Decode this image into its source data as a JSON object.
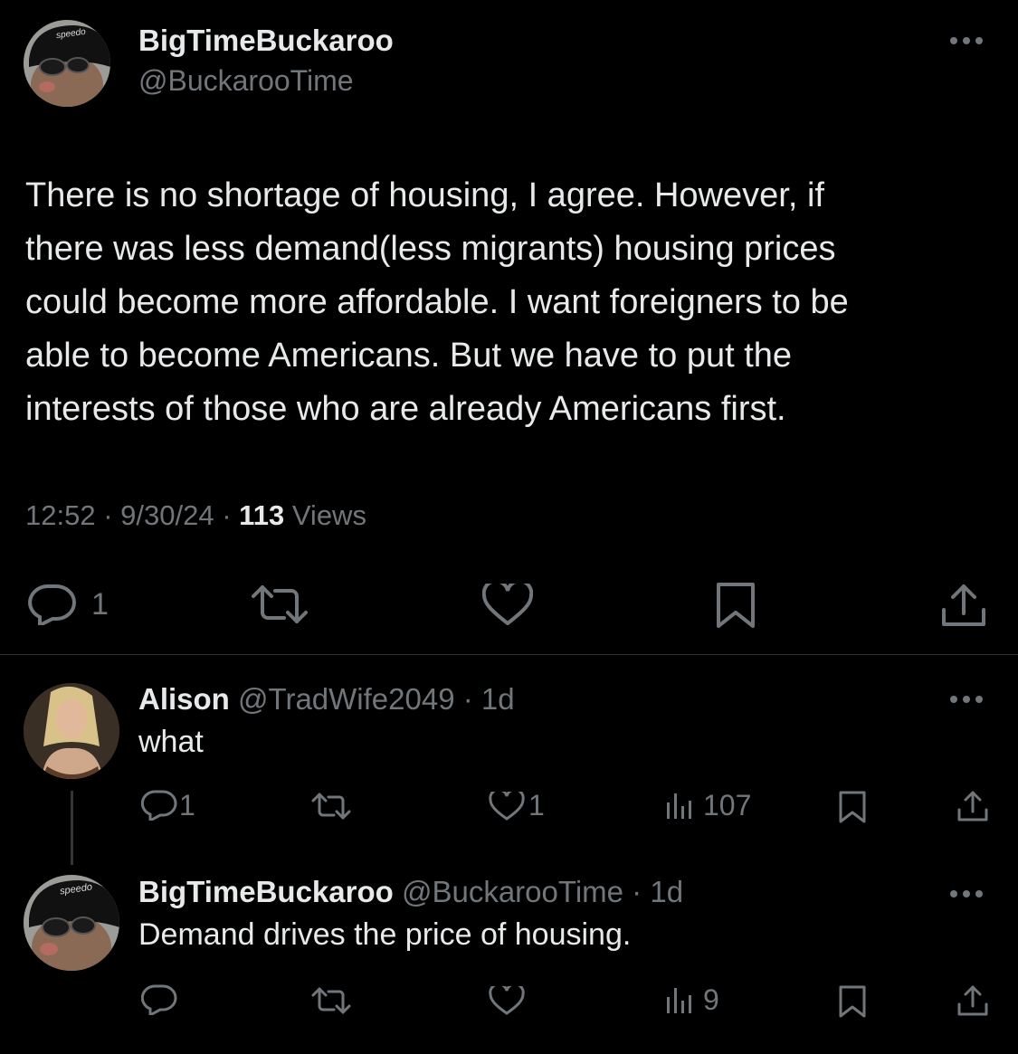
{
  "main_post": {
    "display_name": "BigTimeBuckaroo",
    "handle": "@BuckarooTime",
    "avatar_cap_text": "speedo",
    "text_lines": [
      "There is no shortage of housing, I agree. However, if",
      "there was less demand(less migrants) housing prices",
      "could become more affordable. I want foreigners to be",
      "able to become Americans. But we have to put the",
      "interests of those who are already Americans first."
    ],
    "time": "12:52",
    "date": "9/30/24",
    "views_count": "113",
    "views_label": "Views",
    "reply_count": "1",
    "icons": [
      "reply-icon",
      "retweet-icon",
      "like-icon",
      "bookmark-icon",
      "share-icon"
    ]
  },
  "replies": [
    {
      "display_name": "Alison",
      "handle": "@TradWife2049",
      "age": "1d",
      "text": "what",
      "reply_count": "1",
      "like_count": "1",
      "views_count": "107"
    },
    {
      "display_name": "BigTimeBuckaroo",
      "handle": "@BuckarooTime",
      "age": "1d",
      "text": "Demand drives the price of housing.",
      "avatar_cap_text": "speedo",
      "views_count": "9"
    }
  ],
  "separator": "·",
  "colors": {
    "background": "#000000",
    "text": "#e7e9ea",
    "muted": "#71767b",
    "divider": "#2f3336"
  }
}
